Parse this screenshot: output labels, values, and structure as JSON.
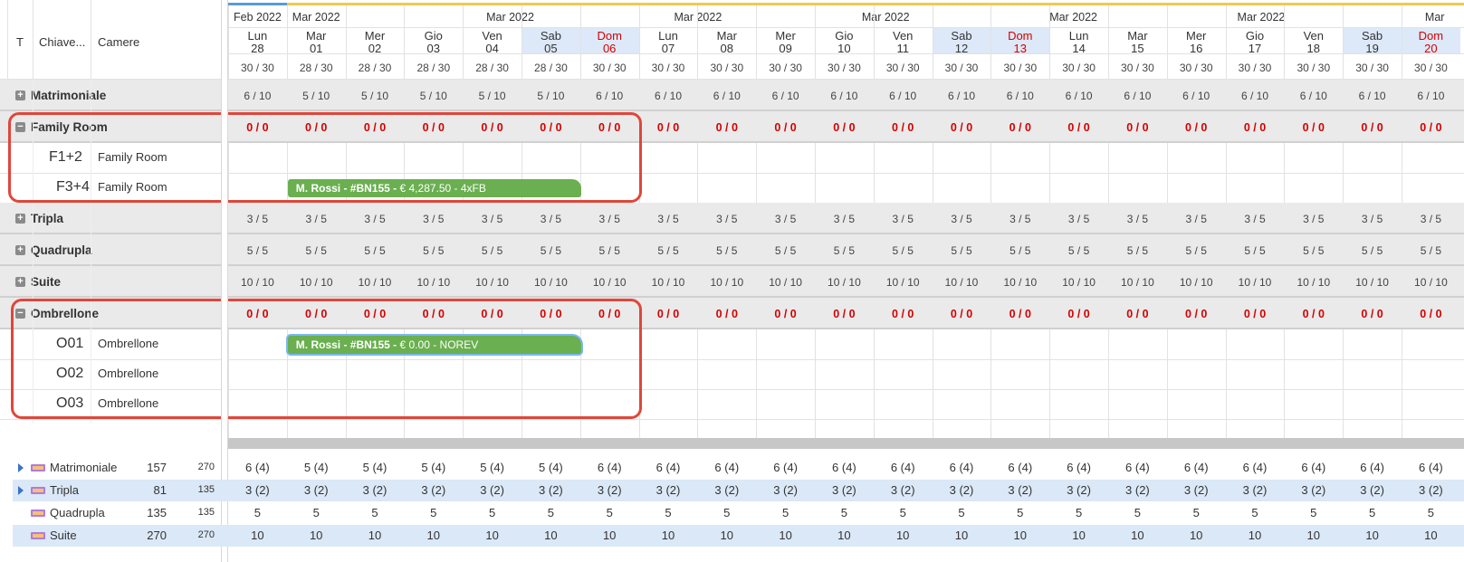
{
  "columns": {
    "t": "T",
    "key": "Chiave...",
    "rooms": "Camere"
  },
  "months": [
    {
      "label": "Feb 2022"
    },
    {
      "label": "Mar 2022"
    },
    {
      "label": "Mar 2022"
    },
    {
      "label": "Mar 2022"
    },
    {
      "label": "Mar 2022"
    },
    {
      "label": "Mar 2022"
    },
    {
      "label": "Mar 2022"
    },
    {
      "label": "Mar"
    }
  ],
  "days": [
    {
      "dow": "Lun",
      "num": "28",
      "total": "30 / 30",
      "weekend": ""
    },
    {
      "dow": "Mar",
      "num": "01",
      "total": "28 / 30",
      "weekend": ""
    },
    {
      "dow": "Mer",
      "num": "02",
      "total": "28 / 30",
      "weekend": ""
    },
    {
      "dow": "Gio",
      "num": "03",
      "total": "28 / 30",
      "weekend": ""
    },
    {
      "dow": "Ven",
      "num": "04",
      "total": "28 / 30",
      "weekend": ""
    },
    {
      "dow": "Sab",
      "num": "05",
      "total": "28 / 30",
      "weekend": "sat"
    },
    {
      "dow": "Dom",
      "num": "06",
      "total": "30 / 30",
      "weekend": "sun"
    },
    {
      "dow": "Lun",
      "num": "07",
      "total": "30 / 30",
      "weekend": ""
    },
    {
      "dow": "Mar",
      "num": "08",
      "total": "30 / 30",
      "weekend": ""
    },
    {
      "dow": "Mer",
      "num": "09",
      "total": "30 / 30",
      "weekend": ""
    },
    {
      "dow": "Gio",
      "num": "10",
      "total": "30 / 30",
      "weekend": ""
    },
    {
      "dow": "Ven",
      "num": "11",
      "total": "30 / 30",
      "weekend": ""
    },
    {
      "dow": "Sab",
      "num": "12",
      "total": "30 / 30",
      "weekend": "sat"
    },
    {
      "dow": "Dom",
      "num": "13",
      "total": "30 / 30",
      "weekend": "sun"
    },
    {
      "dow": "Lun",
      "num": "14",
      "total": "30 / 30",
      "weekend": ""
    },
    {
      "dow": "Mar",
      "num": "15",
      "total": "30 / 30",
      "weekend": ""
    },
    {
      "dow": "Mer",
      "num": "16",
      "total": "30 / 30",
      "weekend": ""
    },
    {
      "dow": "Gio",
      "num": "17",
      "total": "30 / 30",
      "weekend": ""
    },
    {
      "dow": "Ven",
      "num": "18",
      "total": "30 / 30",
      "weekend": ""
    },
    {
      "dow": "Sab",
      "num": "19",
      "total": "30 / 30",
      "weekend": "sat"
    },
    {
      "dow": "Dom",
      "num": "20",
      "total": "30 / 30",
      "weekend": "sun"
    }
  ],
  "groups": [
    {
      "name": "Matrimoniale",
      "expanded": false,
      "avail": [
        "6 / 10",
        "5 / 10",
        "5 / 10",
        "5 / 10",
        "5 / 10",
        "5 / 10",
        "6 / 10",
        "6 / 10",
        "6 / 10",
        "6 / 10",
        "6 / 10",
        "6 / 10",
        "6 / 10",
        "6 / 10",
        "6 / 10",
        "6 / 10",
        "6 / 10",
        "6 / 10",
        "6 / 10",
        "6 / 10",
        "6 / 10"
      ]
    },
    {
      "name": "Family Room",
      "expanded": true,
      "zero": "0 / 0",
      "rooms": [
        {
          "key": "F1+2",
          "type": "Family Room"
        },
        {
          "key": "F3+4",
          "type": "Family Room",
          "booking": {
            "guest": "M. Rossi - #BN155 - ",
            "detail": "€ 4,287.50 - 4xFB"
          }
        }
      ]
    },
    {
      "name": "Tripla",
      "expanded": false,
      "avail": [
        "3 / 5",
        "3 / 5",
        "3 / 5",
        "3 / 5",
        "3 / 5",
        "3 / 5",
        "3 / 5",
        "3 / 5",
        "3 / 5",
        "3 / 5",
        "3 / 5",
        "3 / 5",
        "3 / 5",
        "3 / 5",
        "3 / 5",
        "3 / 5",
        "3 / 5",
        "3 / 5",
        "3 / 5",
        "3 / 5",
        "3 / 5"
      ]
    },
    {
      "name": "Quadrupla",
      "expanded": false,
      "avail": [
        "5 / 5",
        "5 / 5",
        "5 / 5",
        "5 / 5",
        "5 / 5",
        "5 / 5",
        "5 / 5",
        "5 / 5",
        "5 / 5",
        "5 / 5",
        "5 / 5",
        "5 / 5",
        "5 / 5",
        "5 / 5",
        "5 / 5",
        "5 / 5",
        "5 / 5",
        "5 / 5",
        "5 / 5",
        "5 / 5",
        "5 / 5"
      ]
    },
    {
      "name": "Suite",
      "expanded": false,
      "avail": [
        "10 / 10",
        "10 / 10",
        "10 / 10",
        "10 / 10",
        "10 / 10",
        "10 / 10",
        "10 / 10",
        "10 / 10",
        "10 / 10",
        "10 / 10",
        "10 / 10",
        "10 / 10",
        "10 / 10",
        "10 / 10",
        "10 / 10",
        "10 / 10",
        "10 / 10",
        "10 / 10",
        "10 / 10",
        "10 / 10",
        "10 / 10"
      ]
    },
    {
      "name": "Ombrellone",
      "expanded": true,
      "zero": "0 / 0",
      "rooms": [
        {
          "key": "O01",
          "type": "Ombrellone",
          "booking": {
            "guest": "M. Rossi - #BN155 - ",
            "detail": "€ 0.00 - NOREV"
          }
        },
        {
          "key": "O02",
          "type": "Ombrellone"
        },
        {
          "key": "O03",
          "type": "Ombrellone"
        }
      ]
    }
  ],
  "summary": [
    {
      "name": "Matrimoniale",
      "a": "157",
      "b": "270",
      "expand": true,
      "values": [
        "6 (4)",
        "5 (4)",
        "5 (4)",
        "5 (4)",
        "5 (4)",
        "5 (4)",
        "6 (4)",
        "6 (4)",
        "6 (4)",
        "6 (4)",
        "6 (4)",
        "6 (4)",
        "6 (4)",
        "6 (4)",
        "6 (4)",
        "6 (4)",
        "6 (4)",
        "6 (4)",
        "6 (4)",
        "6 (4)",
        "6 (4)"
      ]
    },
    {
      "name": "Tripla",
      "a": "81",
      "b": "135",
      "expand": true,
      "values": [
        "3 (2)",
        "3 (2)",
        "3 (2)",
        "3 (2)",
        "3 (2)",
        "3 (2)",
        "3 (2)",
        "3 (2)",
        "3 (2)",
        "3 (2)",
        "3 (2)",
        "3 (2)",
        "3 (2)",
        "3 (2)",
        "3 (2)",
        "3 (2)",
        "3 (2)",
        "3 (2)",
        "3 (2)",
        "3 (2)",
        "3 (2)"
      ]
    },
    {
      "name": "Quadrupla",
      "a": "135",
      "b": "135",
      "expand": false,
      "values": [
        "5",
        "5",
        "5",
        "5",
        "5",
        "5",
        "5",
        "5",
        "5",
        "5",
        "5",
        "5",
        "5",
        "5",
        "5",
        "5",
        "5",
        "5",
        "5",
        "5",
        "5"
      ]
    },
    {
      "name": "Suite",
      "a": "270",
      "b": "270",
      "expand": false,
      "values": [
        "10",
        "10",
        "10",
        "10",
        "10",
        "10",
        "10",
        "10",
        "10",
        "10",
        "10",
        "10",
        "10",
        "10",
        "10",
        "10",
        "10",
        "10",
        "10",
        "10",
        "10"
      ]
    }
  ],
  "colors": {
    "booking": "#6aaf50",
    "highlight": "#e0463a",
    "weekend_bg": "#dde9f8",
    "sunday_text": "#d40000",
    "zero_text": "#d40000"
  }
}
